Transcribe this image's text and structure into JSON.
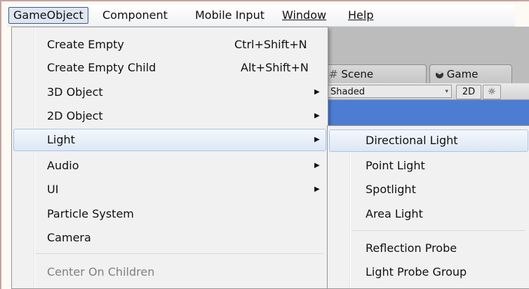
{
  "menubar": {
    "items": [
      "GameObject",
      "Component",
      "Mobile Input",
      "Window",
      "Help"
    ]
  },
  "editor": {
    "tabs": [
      {
        "icon": "hash-icon",
        "label": "Scene"
      },
      {
        "icon": "pacman-icon",
        "label": "Game"
      }
    ],
    "shading_mode": "Shaded",
    "toggle_2d": "2D"
  },
  "gameobject_menu": {
    "items": [
      {
        "label": "Create Empty",
        "shortcut": "Ctrl+Shift+N"
      },
      {
        "label": "Create Empty Child",
        "shortcut": "Alt+Shift+N"
      },
      {
        "label": "3D Object",
        "submenu": true
      },
      {
        "label": "2D Object",
        "submenu": true
      },
      {
        "label": "Light",
        "submenu": true,
        "highlighted": true
      },
      {
        "label": "Audio",
        "submenu": true
      },
      {
        "label": "UI",
        "submenu": true
      },
      {
        "label": "Particle System"
      },
      {
        "label": "Camera"
      },
      {
        "label": "Center On Children",
        "disabled": true
      }
    ]
  },
  "light_submenu": {
    "items": [
      {
        "label": "Directional Light",
        "highlighted": true
      },
      {
        "label": "Point Light"
      },
      {
        "label": "Spotlight"
      },
      {
        "label": "Area Light"
      },
      {
        "label": "Reflection Probe"
      },
      {
        "label": "Light Probe Group"
      }
    ]
  }
}
